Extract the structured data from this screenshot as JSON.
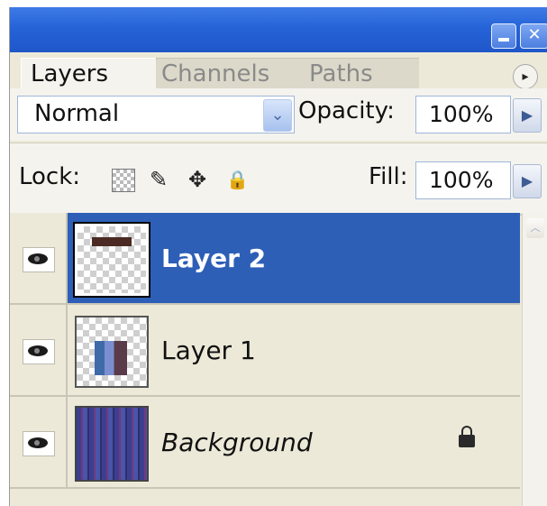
{
  "window": {
    "minimize_icon": "minimize-icon",
    "close_icon": "close-icon",
    "close_glyph": "✕"
  },
  "tabs": [
    {
      "label": "Layers",
      "active": true
    },
    {
      "label": "Channels",
      "active": false
    },
    {
      "label": "Paths",
      "active": false
    }
  ],
  "flyout_glyph": "▸",
  "blend": {
    "mode": "Normal",
    "dropdown_glyph": "⌄"
  },
  "opacity": {
    "label": "Opacity:",
    "value": "100%",
    "stepper_glyph": "▶"
  },
  "lock": {
    "label": "Lock:",
    "icons": [
      "lock-transparent-icon",
      "lock-image-brush-icon",
      "lock-position-move-icon",
      "lock-all-padlock-icon"
    ],
    "brush_glyph": "✎",
    "move_glyph": "✥",
    "padlock_glyph": "🔒"
  },
  "fill": {
    "label": "Fill:",
    "value": "100%",
    "stepper_glyph": "▶"
  },
  "layers": [
    {
      "name": "Layer 2",
      "visible": true,
      "selected": true,
      "locked": false
    },
    {
      "name": "Layer 1",
      "visible": true,
      "selected": false,
      "locked": false
    },
    {
      "name": "Background",
      "visible": true,
      "selected": false,
      "locked": true,
      "italic": true
    }
  ],
  "scrollbar": {
    "up_glyph": "︿"
  },
  "colors": {
    "selection": "#2d5fb7",
    "titlebar": "#2563d8",
    "panel": "#ece9d8"
  }
}
